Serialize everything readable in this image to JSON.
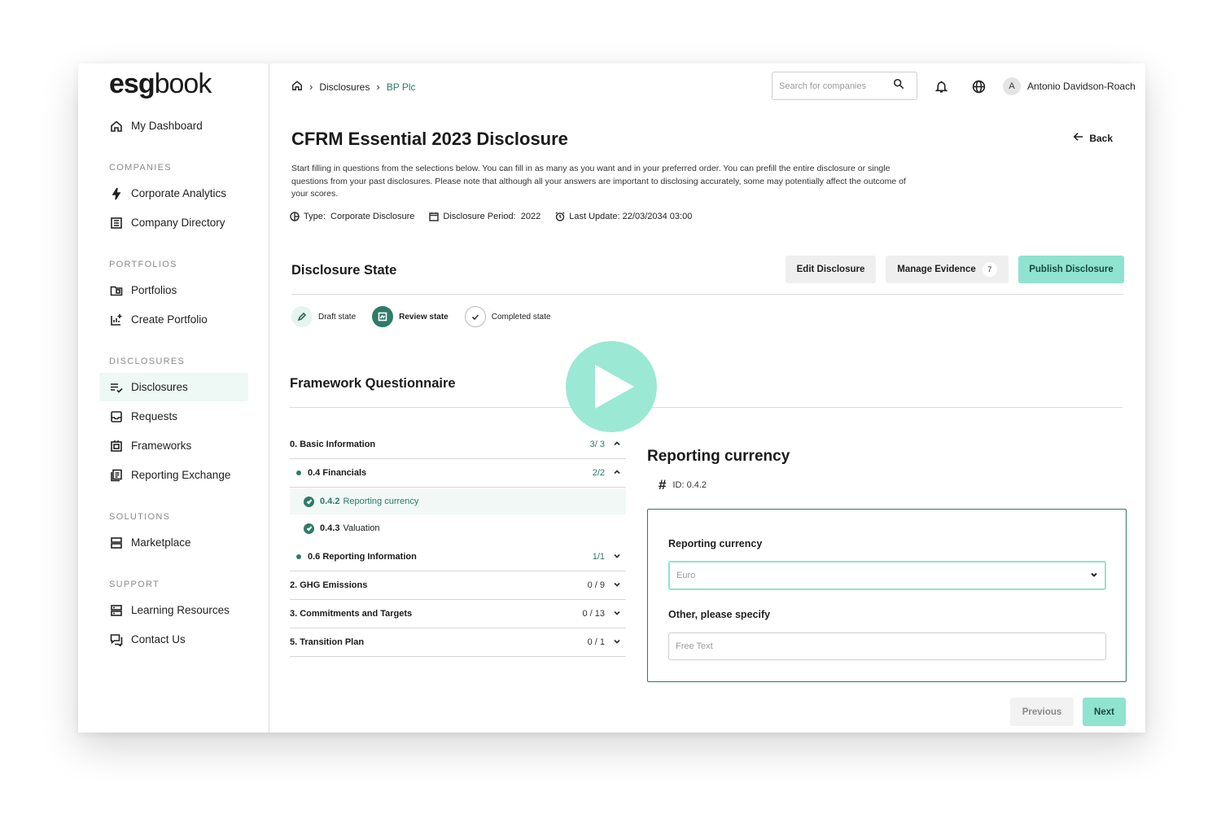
{
  "sidebar": {
    "logo_bold": "esg",
    "logo_light": "book",
    "dashboard": "My Dashboard",
    "sections": [
      {
        "title": "COMPANIES",
        "items": [
          "Corporate Analytics",
          "Company Directory"
        ]
      },
      {
        "title": "PORTFOLIOS",
        "items": [
          "Portfolios",
          "Create Portfolio"
        ]
      },
      {
        "title": "DISCLOSURES",
        "items": [
          "Disclosures",
          "Requests",
          "Frameworks",
          "Reporting Exchange"
        ]
      },
      {
        "title": "SOLUTIONS",
        "items": [
          "Marketplace"
        ]
      },
      {
        "title": "SUPPORT",
        "items": [
          "Learning Resources",
          "Contact Us"
        ]
      }
    ],
    "active_item": "Disclosures"
  },
  "topbar": {
    "breadcrumb": [
      "Disclosures",
      "BP Plc"
    ],
    "search_placeholder": "Search for companies",
    "avatar_initial": "A",
    "user_name": "Antonio Davidson-Roach"
  },
  "page": {
    "title": "CFRM Essential 2023 Disclosure",
    "back_label": "Back",
    "intro": "Start filling in questions from the selections below.  You can fill in as many as you want and in your preferred order. You can prefill the entire disclosure or single questions from your past disclosures. Please note that although all your answers are important to disclosing accurately, some may potentially affect the outcome of your scores.",
    "meta": {
      "type_label": "Type:",
      "type_value": "Corporate Disclosure",
      "period_label": "Disclosure Period:",
      "period_value": "2022",
      "update_label": "Last Update:",
      "update_value": "22/03/2034 03:00"
    }
  },
  "disclosure_state": {
    "title": "Disclosure State",
    "edit_label": "Edit Disclosure",
    "evidence_label": "Manage Evidence",
    "evidence_count": "7",
    "publish_label": "Publish Disclosure",
    "states": [
      {
        "label": "Draft state",
        "icon": "pencil-icon"
      },
      {
        "label": "Review state",
        "icon": "review-icon"
      },
      {
        "label": "Completed state",
        "icon": "check-icon"
      }
    ],
    "current_state": "Review state"
  },
  "questionnaire": {
    "title": "Framework Questionnaire",
    "rows": [
      {
        "label": "0. Basic Information",
        "count": "3/ 3",
        "expanded": true
      },
      {
        "label": "0.4 Financials",
        "count": "2/2",
        "expanded": true
      },
      {
        "code": "0.4.2",
        "name": "Reporting currency",
        "selected": true
      },
      {
        "code": "0.4.3",
        "name": "Valuation"
      },
      {
        "label": "0.6 Reporting Information",
        "count": "1/1"
      },
      {
        "label": "2. GHG Emissions",
        "count": "0 / 9"
      },
      {
        "label": "3. Commitments and Targets",
        "count": "0 / 13"
      },
      {
        "label": "5. Transition Plan",
        "count": "0 / 1"
      }
    ]
  },
  "question": {
    "title": "Reporting currency",
    "id": "ID: 0.4.2",
    "field1_label": "Reporting currency",
    "field1_value": "Euro",
    "field2_label": "Other, please specify",
    "field2_placeholder": "Free Text"
  },
  "footer": {
    "previous_label": "Previous",
    "next_label": "Next"
  },
  "colors": {
    "accent": "#8fe3cf",
    "primary_dark": "#2f7a69",
    "play_overlay": "#9be8d4"
  }
}
